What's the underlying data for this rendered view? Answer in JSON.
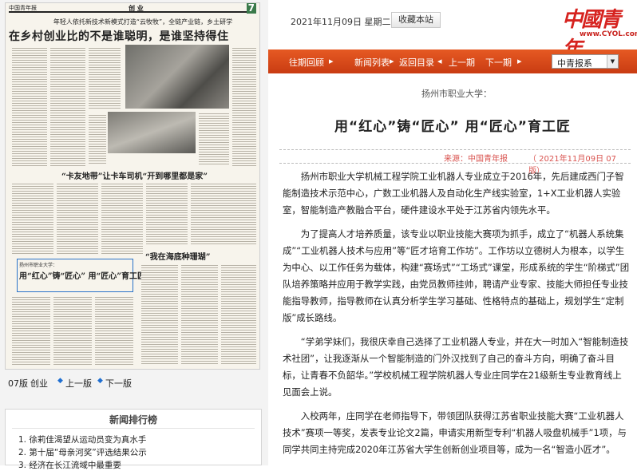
{
  "paper": {
    "masthead_logo": "中国青年报",
    "section": "创 业",
    "page_no": "7",
    "kicker": "年轻人依托新技术新模式打造“云牧牧”，全链产业链，乡土研学",
    "headline": "在乡村创业比的不是谁聪明，是谁坚持得住",
    "mid_headline": "“卡友地带”让卡车司机“开到哪里都是家”",
    "sub_headline": "“我在海底种珊瑚”",
    "box_small": "扬州市职业大学：",
    "box_title": "用“红心”铸“匠心” 用“匠心”育工匠"
  },
  "pager": {
    "page_label": "07版",
    "section_label": "创业",
    "prev": "上一版",
    "next": "下一版"
  },
  "ranking": {
    "title": "新闻排行榜",
    "items": [
      "1. 徐莉佳渴望从运动员变为真水手",
      "2. 第十届“母亲河奖”评选结果公示",
      "3. 经济在长江流域中最重要"
    ]
  },
  "topbar": {
    "date": "2021年11月09日  星期二",
    "favorite_button": "收藏本站",
    "logo_text": "中國青年",
    "logo_url": "www.CYOL.com"
  },
  "nav": {
    "items": [
      "往期回顾",
      "新闻列表",
      "返回目录",
      "上一期",
      "下一期"
    ],
    "select_value": "中青报系"
  },
  "article": {
    "subhead": "扬州市职业大学：",
    "title": "用“红心”铸“匠心” 用“匠心”育工匠",
    "source": "来源：中国青年报",
    "date": "（ 2021年11月09日   07 版）",
    "paragraphs": [
      "扬州市职业大学机械工程学院工业机器人专业成立于2016年，先后建成西门子智能制造技术示范中心，广数工业机器人及自动化生产线实验室，1+X工业机器人实验室，智能制造产教融合平台，硬件建设水平处于江苏省内领先水平。",
      "为了提高人才培养质量，该专业以职业技能大赛项为抓手，成立了“机器人系统集成”“工业机器人技术与应用”等“匠才培育工作坊”。工作坊以立德树人为根本，以学生为中心、以工作任务为载体，构建“赛场式”“工场式”课堂，形成系统的学生“阶梯式”团队培养策略并应用于教学实践，由党员教师挂帅，聘请产业专家、技能大师担任专业技能指导教师，指导教师在认真分析学生学习基础、性格特点的基础上，规划学生“定制版”成长路线。",
      "“学弟学妹们，我很庆幸自己选择了工业机器人专业，并在大一时加入“智能制造技术社团”，让我逐渐从一个智能制造的门外汉找到了自己的奋斗方向，明确了奋斗目标，让青春不负韶华。”学校机械工程学院机器人专业庄同学在21级新生专业教育线上见面会上说。",
      "入校两年，庄同学在老师指导下，带领团队获得江苏省职业技能大赛“工业机器人技术”赛项一等奖，发表专业论文2篇，申请实用新型专利“机器人吸盘机械手”1项，与同学共同主持完成2020年江苏省大学生创新创业项目等，成为一名“智造小匠才”。"
    ]
  },
  "colors": {
    "nav_bg": "#d9481a",
    "logo_red": "#d6231f",
    "meta_red": "#d9534f",
    "link_blue": "#1f6fd1"
  }
}
